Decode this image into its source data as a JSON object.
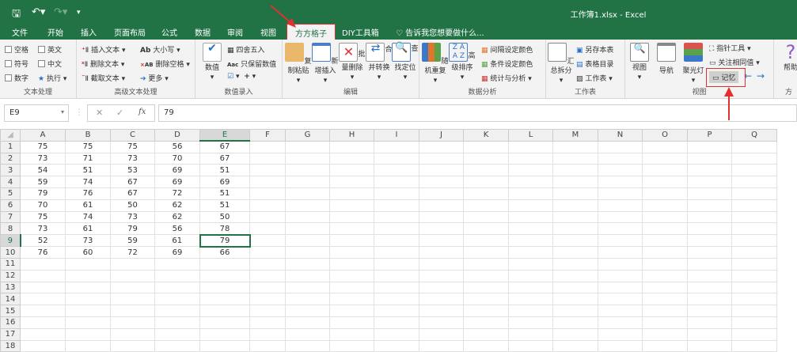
{
  "window": {
    "title": "工作簿1.xlsx - Excel"
  },
  "qat": {
    "save_icon": "save-icon",
    "undo_icon": "undo-icon",
    "redo_icon": "redo-icon",
    "customize_icon": "customize-icon"
  },
  "tabs": [
    {
      "label": "文件"
    },
    {
      "label": "开始"
    },
    {
      "label": "插入"
    },
    {
      "label": "页面布局"
    },
    {
      "label": "公式"
    },
    {
      "label": "数据"
    },
    {
      "label": "审阅"
    },
    {
      "label": "视图"
    },
    {
      "label": "方方格子",
      "active": true
    },
    {
      "label": "DIY工具箱"
    }
  ],
  "tell_me": "告诉我您想要做什么...",
  "ribbon": {
    "text_processing": {
      "label": "文本处理",
      "items": [
        "空格",
        "英文",
        "符号",
        "中文",
        "数字",
        "执行"
      ]
    },
    "advanced_text": {
      "label": "高级文本处理",
      "items": [
        "插入文本",
        "删除文本",
        "截取文本",
        "大小写",
        "删除空格",
        "更多"
      ]
    },
    "numeric_entry": {
      "label": "数值录入",
      "items": [
        "数值",
        "四舍五入",
        "只保留数值"
      ]
    },
    "edit": {
      "label": "编辑",
      "items": [
        "复制粘贴",
        "新增插入",
        "批量删除",
        "合并转换",
        "查找定位"
      ]
    },
    "data_analysis": {
      "label": "数据分析",
      "items": [
        "随机重复",
        "高级排序",
        "间隔设定颜色",
        "条件设定颜色",
        "统计与分析"
      ]
    },
    "worksheet": {
      "label": "工作表",
      "items": [
        "汇总拆分",
        "另存本表",
        "表格目录",
        "工作表"
      ]
    },
    "view": {
      "label": "视图",
      "items": [
        "视图",
        "导航",
        "聚光灯",
        "指针工具",
        "关注相同值",
        "记忆"
      ]
    },
    "help": {
      "label": "方",
      "items": [
        "帮助"
      ]
    }
  },
  "formula_bar": {
    "name_box": "E9",
    "value": "79",
    "fx": "fx"
  },
  "sheet": {
    "columns": [
      "A",
      "B",
      "C",
      "D",
      "E",
      "F",
      "G",
      "H",
      "I",
      "J",
      "K",
      "L",
      "M",
      "N",
      "O",
      "P",
      "Q"
    ],
    "selected_column": "E",
    "selected_row": 9,
    "rows": [
      [
        75,
        75,
        75,
        56,
        67
      ],
      [
        73,
        71,
        73,
        70,
        67
      ],
      [
        54,
        51,
        53,
        69,
        51
      ],
      [
        59,
        74,
        67,
        69,
        69
      ],
      [
        79,
        76,
        67,
        72,
        51
      ],
      [
        70,
        61,
        50,
        62,
        51
      ],
      [
        75,
        74,
        73,
        62,
        50
      ],
      [
        73,
        61,
        79,
        56,
        78
      ],
      [
        52,
        73,
        59,
        61,
        79
      ],
      [
        76,
        60,
        72,
        69,
        66
      ]
    ],
    "row_count": 18
  },
  "colors": {
    "excel_green": "#217346",
    "annotation_red": "#e03030"
  }
}
